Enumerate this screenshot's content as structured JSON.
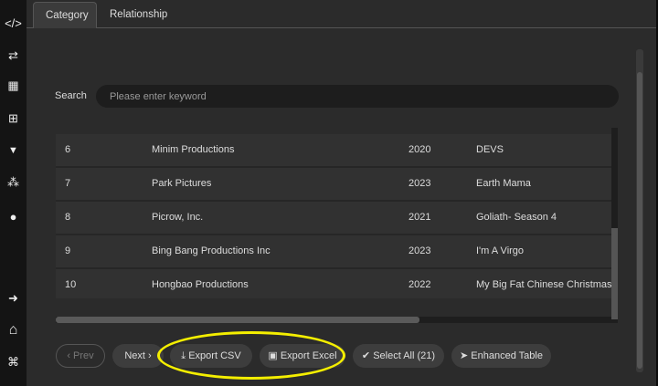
{
  "sidebar": {
    "items": [
      {
        "icon": "code-icon",
        "glyph": "</>"
      },
      {
        "icon": "swap-icon",
        "glyph": "⇄"
      },
      {
        "icon": "table-icon",
        "glyph": "▦"
      },
      {
        "icon": "hierarchy-icon",
        "glyph": "⊞"
      },
      {
        "icon": "filter-icon",
        "glyph": "▼"
      },
      {
        "icon": "network-icon",
        "glyph": "⁂"
      },
      {
        "icon": "globe-icon",
        "glyph": "●"
      },
      {
        "icon": "logout-icon",
        "glyph": "➜"
      },
      {
        "icon": "home-icon",
        "glyph": "⌂"
      },
      {
        "icon": "command-icon",
        "glyph": "⌘"
      }
    ]
  },
  "tabs": [
    {
      "label": "Category",
      "active": true
    },
    {
      "label": "Relationship",
      "active": false
    }
  ],
  "search": {
    "label": "Search",
    "placeholder": "Please enter keyword",
    "value": ""
  },
  "table": {
    "rows": [
      [
        "6",
        "Minim Productions",
        "2020",
        "DEVS"
      ],
      [
        "7",
        "Park Pictures",
        "2023",
        "Earth Mama"
      ],
      [
        "8",
        "Picrow, Inc.",
        "2021",
        "Goliath- Season 4"
      ],
      [
        "9",
        "Bing Bang Productions Inc",
        "2023",
        "I'm A Virgo"
      ],
      [
        "10",
        "Hongbao Productions",
        "2022",
        "My Big Fat Chinese Christmas"
      ]
    ]
  },
  "buttons": {
    "prev": "‹ Prev",
    "next": "Next ›",
    "export_csv": "⤓ Export CSV",
    "export_excel": "▣ Export Excel",
    "select_all": "✔ Select All (21)",
    "enhanced_table": "➤ Enhanced Table"
  },
  "colors": {
    "highlight": "#f4ee00",
    "panel": "#2b2b2b"
  }
}
